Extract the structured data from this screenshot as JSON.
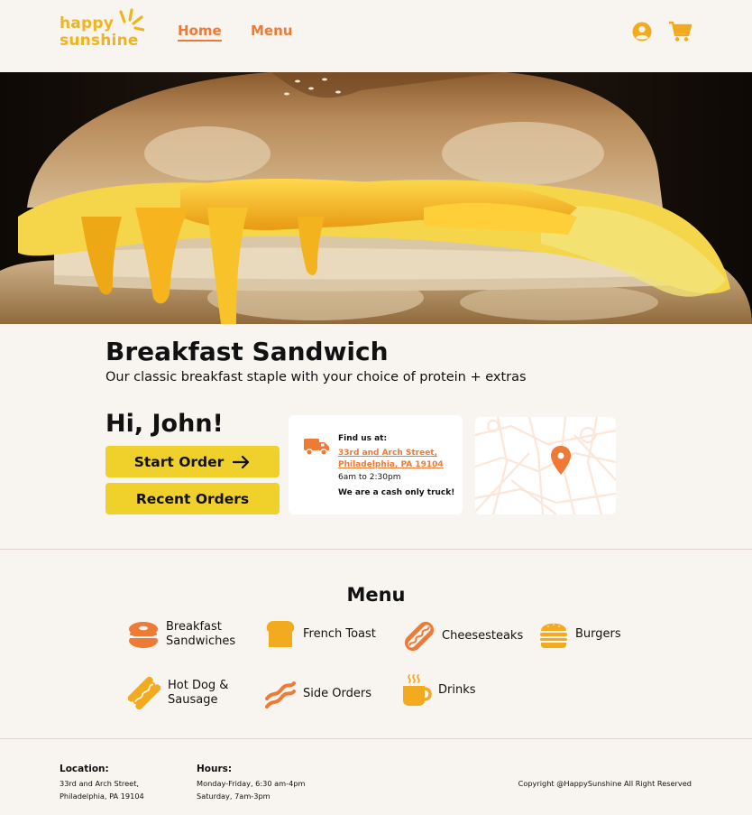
{
  "header": {
    "logo_line1": "happy",
    "logo_line2": "sunshine",
    "nav_home": "Home",
    "nav_menu": "Menu"
  },
  "hero": {
    "title": "Breakfast Sandwich",
    "subtitle": "Our classic breakfast staple with your choice of protein + extras"
  },
  "greeting": "Hi, John!",
  "buttons": {
    "start_order": "Start Order",
    "recent_orders": "Recent Orders"
  },
  "info": {
    "label": "Find us at:",
    "address_line1": "33rd and Arch Street,",
    "address_line2": "Philadelphia, PA 19104",
    "hours": "6am to 2:30pm",
    "cash_note": "We are a cash only truck!"
  },
  "menu": {
    "title": "Menu",
    "items": [
      {
        "label_line1": "Breakfast",
        "label_line2": "Sandwiches",
        "icon": "bagel-icon"
      },
      {
        "label_line1": "French Toast",
        "label_line2": "",
        "icon": "toast-icon"
      },
      {
        "label_line1": "Cheesesteaks",
        "label_line2": "",
        "icon": "cheesesteak-icon"
      },
      {
        "label_line1": "Burgers",
        "label_line2": "",
        "icon": "burger-icon"
      },
      {
        "label_line1": "Hot Dog &",
        "label_line2": "Sausage",
        "icon": "hotdog-icon"
      },
      {
        "label_line1": "Side Orders",
        "label_line2": "",
        "icon": "bacon-icon"
      },
      {
        "label_line1": "Drinks",
        "label_line2": "",
        "icon": "coffee-icon"
      }
    ]
  },
  "footer": {
    "location_heading": "Location:",
    "location_line1": "33rd and Arch Street,",
    "location_line2": "Philadelphia, PA 19104",
    "hours_heading": "Hours:",
    "hours_line1": "Monday-Friday, 6:30 am-4pm",
    "hours_line2": "Saturday, 7am-3pm",
    "copyright": "Copyright @HappySunshine All Right Reserved"
  },
  "colors": {
    "accent_orange": "#ee7a35",
    "brand_yellow": "#f0b41e",
    "button_yellow": "#f0d02a",
    "background": "#f8f4f0"
  }
}
